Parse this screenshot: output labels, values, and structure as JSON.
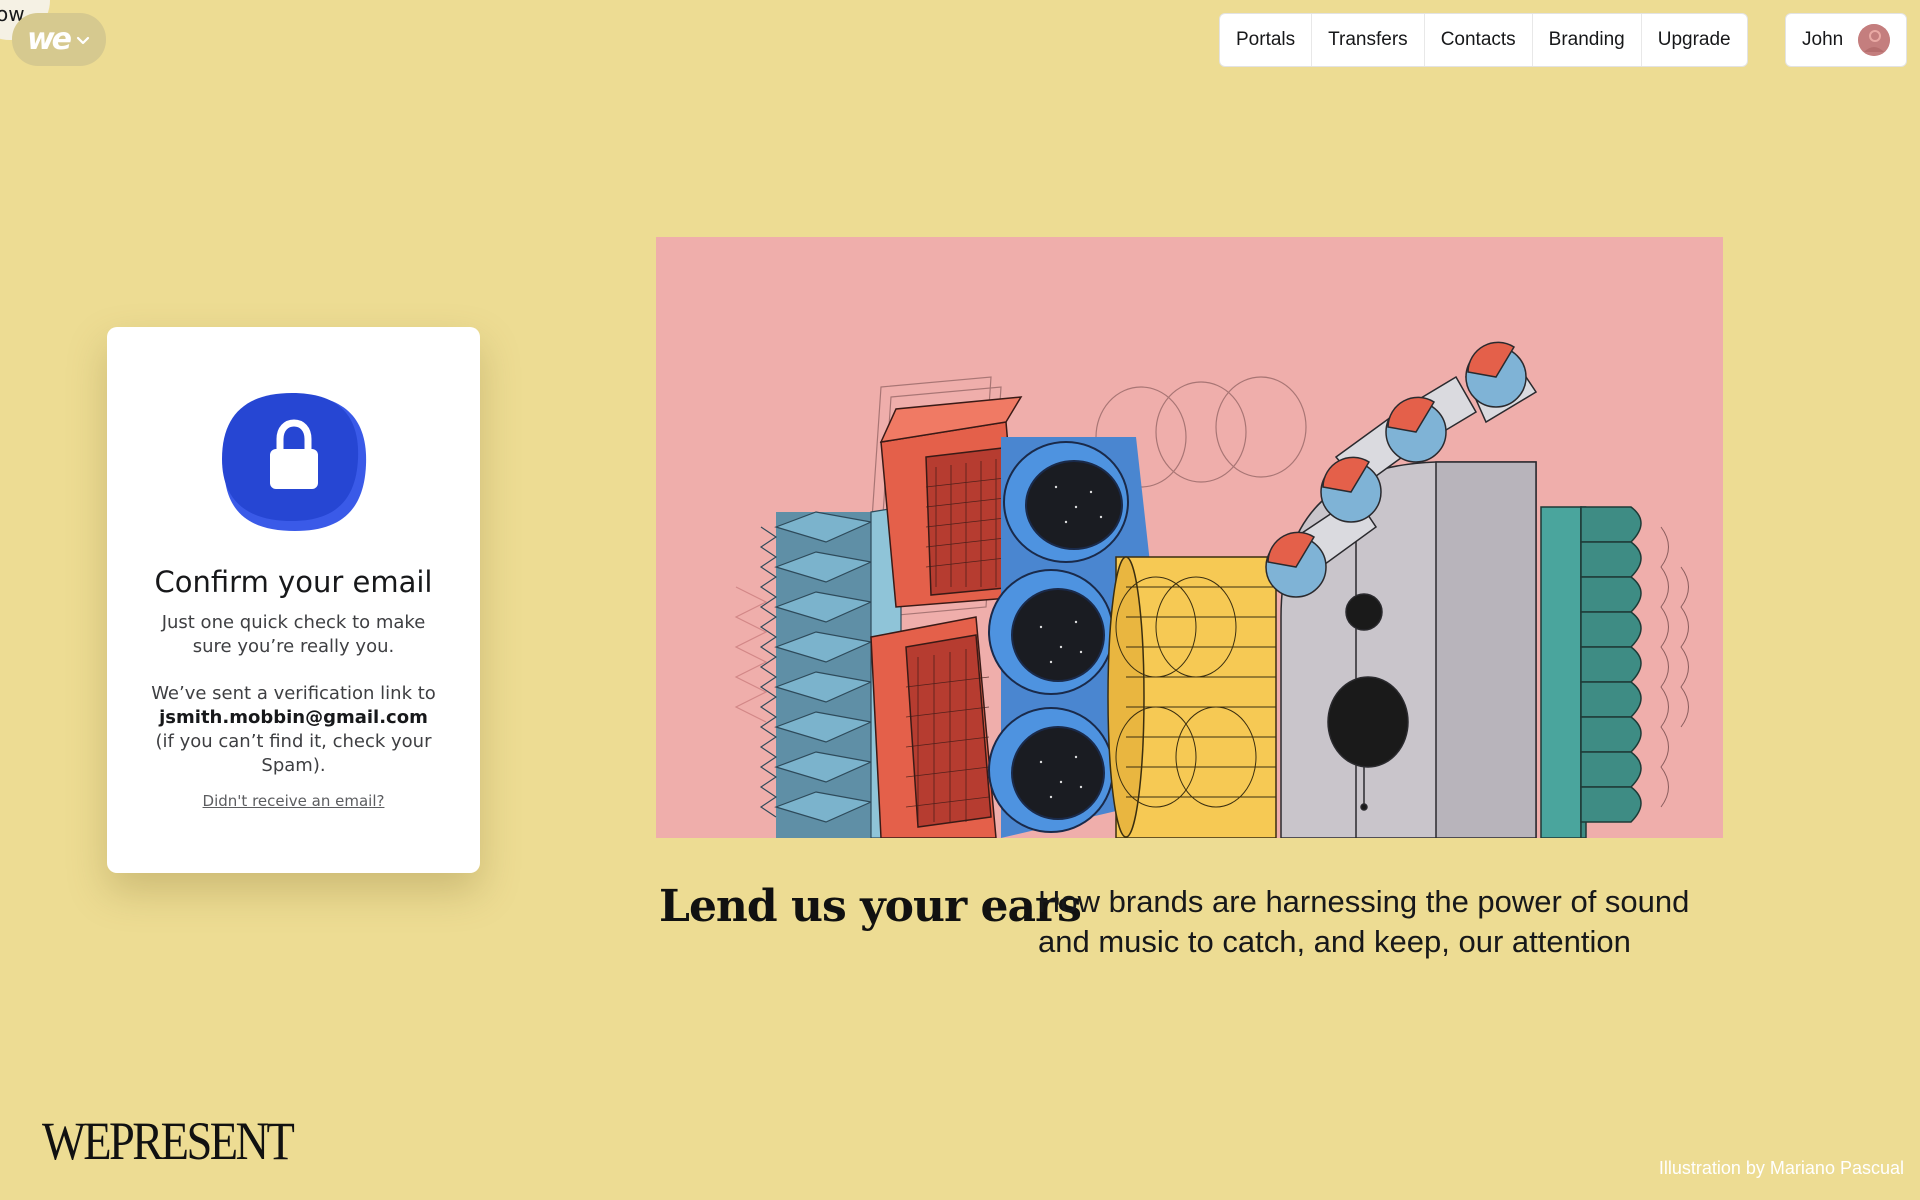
{
  "corner": {
    "text": "ow"
  },
  "logo": {
    "mark": "we",
    "icon": "chevron-down-icon"
  },
  "nav": {
    "items": [
      {
        "label": "Portals"
      },
      {
        "label": "Transfers"
      },
      {
        "label": "Contacts"
      },
      {
        "label": "Branding"
      },
      {
        "label": "Upgrade"
      }
    ]
  },
  "user": {
    "name": "John",
    "avatar_icon": "avatar-icon"
  },
  "card": {
    "icon": "lock-icon",
    "title": "Confirm your email",
    "subtitle": "Just one quick check to make sure you’re really you.",
    "body_before": "We’ve sent a verification link to",
    "email": "jsmith.mobbin@gmail.com",
    "body_after": "(if you can’t find it, check your Spam).",
    "resend_link": "Didn't receive an email?"
  },
  "article": {
    "headline": "Lend us your ears",
    "description": "How brands are harnessing the power of sound and music to catch, and keep, our attention"
  },
  "footer": {
    "brand": "WEPRESENT",
    "credit": "Illustration by Mariano Pascual"
  },
  "colors": {
    "background": "#EDDC93",
    "lock_blue": "#2646D3",
    "illustration_bg": "#EFAEAB"
  }
}
